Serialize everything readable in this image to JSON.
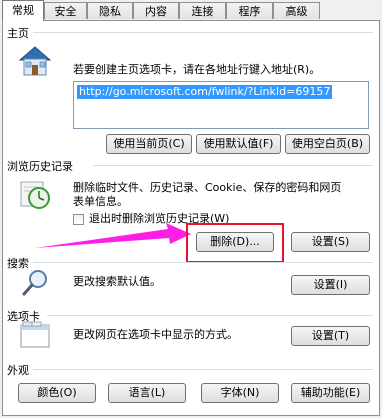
{
  "tabs": [
    "常规",
    "安全",
    "隐私",
    "内容",
    "连接",
    "程序",
    "高级"
  ],
  "home": {
    "title": "主页",
    "desc": "若要创建主页选项卡，请在各地址行键入地址(R)。",
    "url": "http://go.microsoft.com/fwlink/?LinkId=69157",
    "use_current": "使用当前页(C)",
    "use_default": "使用默认值(F)",
    "use_blank": "使用空白页(B)"
  },
  "history": {
    "title": "浏览历史记录",
    "desc_line1": "删除临时文件、历史记录、Cookie、保存的密码和网页",
    "desc_line2": "表单信息。",
    "checkbox_label": "退出时删除浏览历史记录(W)",
    "delete_btn": "删除(D)...",
    "settings_btn": "设置(S)"
  },
  "search": {
    "title": "搜索",
    "desc": "更改搜索默认值。",
    "settings_btn": "设置(I)"
  },
  "tabs_section": {
    "title": "选项卡",
    "desc": "更改网页在选项卡中显示的方式。",
    "settings_btn": "设置(T)"
  },
  "appearance": {
    "title": "外观",
    "colors_btn": "颜色(O)",
    "languages_btn": "语言(L)",
    "fonts_btn": "字体(N)",
    "accessibility_btn": "辅助功能(E)"
  },
  "colors": {
    "highlight": "#e8132f",
    "arrow": "#ff1ee6",
    "selection": "#3399ff"
  },
  "icons": [
    "house-icon",
    "history-clock-icon",
    "magnifier-icon",
    "tabs-window-icon",
    "pink-arrow-icon"
  ]
}
